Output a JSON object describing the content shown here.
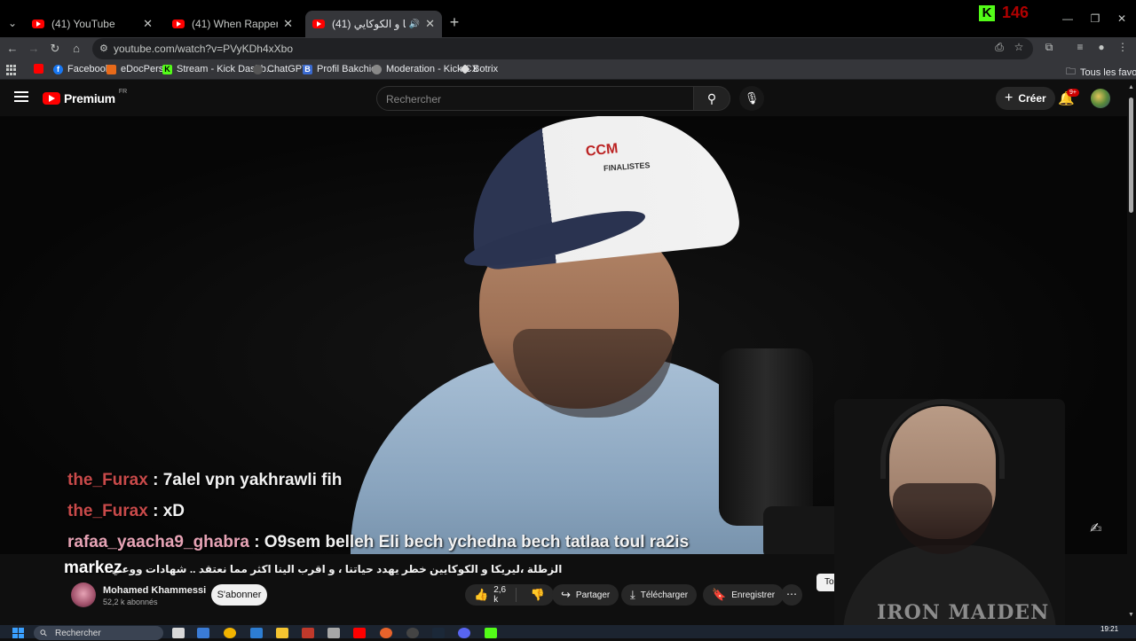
{
  "browser": {
    "tabs": [
      {
        "title": "(41) YouTube",
        "active": false
      },
      {
        "title": "(41) When Rappers Drop Rand",
        "active": false
      },
      {
        "title": "(41) الزطلة ،ليريكا و الكوكايي",
        "active": true
      }
    ],
    "url": "youtube.com/watch?v=PVyKDh4xXbo",
    "bookmarks": [
      {
        "label": "",
        "icon": "youtube-icon",
        "color": "#ff0000"
      },
      {
        "label": "Facebook",
        "icon": "facebook-icon",
        "color": "#1877f2"
      },
      {
        "label": "eDocPerso",
        "icon": "edocperso-icon",
        "color": "#e86a1a"
      },
      {
        "label": "Stream - Kick Dashb...",
        "icon": "kick-icon",
        "color": "#53fc18"
      },
      {
        "label": "ChatGPT",
        "icon": "chatgpt-icon",
        "color": "#888888"
      },
      {
        "label": "Profil Bakchich",
        "icon": "bakchich-icon",
        "color": "#3a6ad0"
      },
      {
        "label": "Moderation - Kick.CX",
        "icon": "moderation-icon",
        "color": "#bbbbbb"
      },
      {
        "label": "Botrix",
        "icon": "botrix-icon",
        "color": "#dddddd"
      }
    ],
    "all_bookmarks": "Tous les favoris"
  },
  "kick_overlay": {
    "viewer_count": "146",
    "logo": "K"
  },
  "youtube": {
    "logo_text": "Premium",
    "country": "FR",
    "search_placeholder": "Rechercher",
    "create_label": "Créer",
    "notification_badge": "9+"
  },
  "chat": [
    {
      "user": "the_Furax",
      "msg": " : 7alel vpn yakhrawli fih",
      "color": "#c84a4a"
    },
    {
      "user": "the_Furax",
      "msg": " : xD",
      "color": "#c84a4a"
    },
    {
      "user": "rafaa_yaacha9_ghabra",
      "msg": " : O9sem belleh Eli bech ychedna bech tatlaa toul ra2is",
      "color": "#e6a3b5"
    }
  ],
  "overlay_name": "markez",
  "video": {
    "title": "الزطلة ،ليريكا و الكوكايين خطر يهدد حياتنا ، و اقرب الينا اكثر مما نعتقد .. شهادات ووعي !",
    "cap_logo": "CCM",
    "cap_text": "FINALISTES",
    "shirt_text": "IRON MAIDEN",
    "channel": "Mohamed Khammessi",
    "subscribers": "52,2 k abonnés",
    "subscribe_label": "S'abonner",
    "likes": "2,6 k",
    "share_label": "Partager",
    "download_label": "Télécharger",
    "save_label": "Enregistrer",
    "partial_button": "To"
  },
  "taskbar": {
    "search_placeholder": "Rechercher",
    "time": "19:21"
  }
}
